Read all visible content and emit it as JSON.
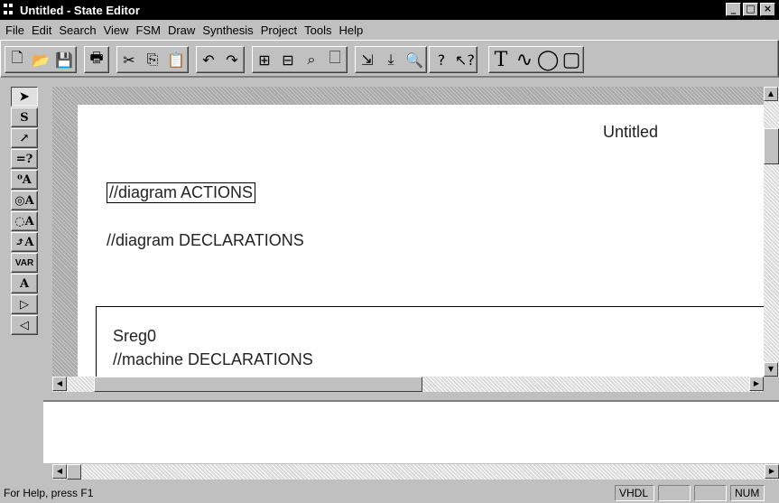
{
  "window": {
    "title": "Untitled - State Editor",
    "controls": {
      "minimize": "_",
      "maximize": "□",
      "close": "×"
    }
  },
  "menu": [
    {
      "label": "File"
    },
    {
      "label": "Edit"
    },
    {
      "label": "Search"
    },
    {
      "label": "View"
    },
    {
      "label": "FSM"
    },
    {
      "label": "Draw"
    },
    {
      "label": "Synthesis"
    },
    {
      "label": "Project"
    },
    {
      "label": "Tools"
    },
    {
      "label": "Help"
    }
  ],
  "toolbar": {
    "file_group": [
      {
        "name": "new-file-icon",
        "glyph": "🗋"
      },
      {
        "name": "open-folder-icon",
        "glyph": "📂"
      },
      {
        "name": "save-disk-icon",
        "glyph": "💾"
      }
    ],
    "print_group": [
      {
        "name": "print-icon",
        "glyph": "🖶"
      }
    ],
    "clipboard_group": [
      {
        "name": "cut-icon",
        "glyph": "✂"
      },
      {
        "name": "copy-icon",
        "glyph": "⎘"
      },
      {
        "name": "paste-icon",
        "glyph": "📋"
      }
    ],
    "undo_group": [
      {
        "name": "undo-icon",
        "glyph": "↶"
      },
      {
        "name": "redo-icon",
        "glyph": "↷"
      }
    ],
    "zoom_group": [
      {
        "name": "zoom-in-icon",
        "glyph": "⊞"
      },
      {
        "name": "zoom-out-icon",
        "glyph": "⊟"
      },
      {
        "name": "zoom-find-icon",
        "glyph": "⌕"
      },
      {
        "name": "zoom-page-icon",
        "glyph": "🗌"
      }
    ],
    "synthesis_group": [
      {
        "name": "compile-icon",
        "glyph": "⇲"
      },
      {
        "name": "download-icon",
        "glyph": "⤓"
      },
      {
        "name": "inspect-icon",
        "glyph": "🔍"
      }
    ],
    "help_group": [
      {
        "name": "help-icon",
        "glyph": "?"
      },
      {
        "name": "context-help-icon",
        "glyph": "↖?"
      }
    ],
    "draw_group": [
      {
        "name": "text-tool-icon",
        "glyph": "T"
      },
      {
        "name": "curve-tool-icon",
        "glyph": "∿"
      },
      {
        "name": "ellipse-tool-icon",
        "glyph": "◯"
      },
      {
        "name": "rectangle-tool-icon",
        "glyph": "▢"
      }
    ]
  },
  "palette": [
    {
      "name": "select-arrow-icon",
      "glyph": "➤",
      "selected": true
    },
    {
      "name": "state-tool-icon",
      "glyph": "S"
    },
    {
      "name": "transition-tool-icon",
      "glyph": "↗"
    },
    {
      "name": "condition-tool-icon",
      "glyph": "=?"
    },
    {
      "name": "entry-action-icon",
      "glyph": "⁰A"
    },
    {
      "name": "state-action-icon",
      "glyph": "◎A"
    },
    {
      "name": "exit-action-icon",
      "glyph": "◌A"
    },
    {
      "name": "transition-action-icon",
      "glyph": "⤴A"
    },
    {
      "name": "variable-tool-icon",
      "glyph": "VAR"
    },
    {
      "name": "text-label-icon",
      "glyph": "A"
    },
    {
      "name": "input-port-icon",
      "glyph": "▷"
    },
    {
      "name": "output-port-icon",
      "glyph": "◁"
    }
  ],
  "diagram": {
    "page_title": "Untitled",
    "actions_text": "//diagram ACTIONS",
    "declarations_text": "//diagram DECLARATIONS",
    "machine_name": "Sreg0",
    "machine_declarations": "//machine DECLARATIONS"
  },
  "statusbar": {
    "help_text": "For Help, press F1",
    "language": "VHDL",
    "blank1": "",
    "blank2": "",
    "num": "NUM"
  }
}
